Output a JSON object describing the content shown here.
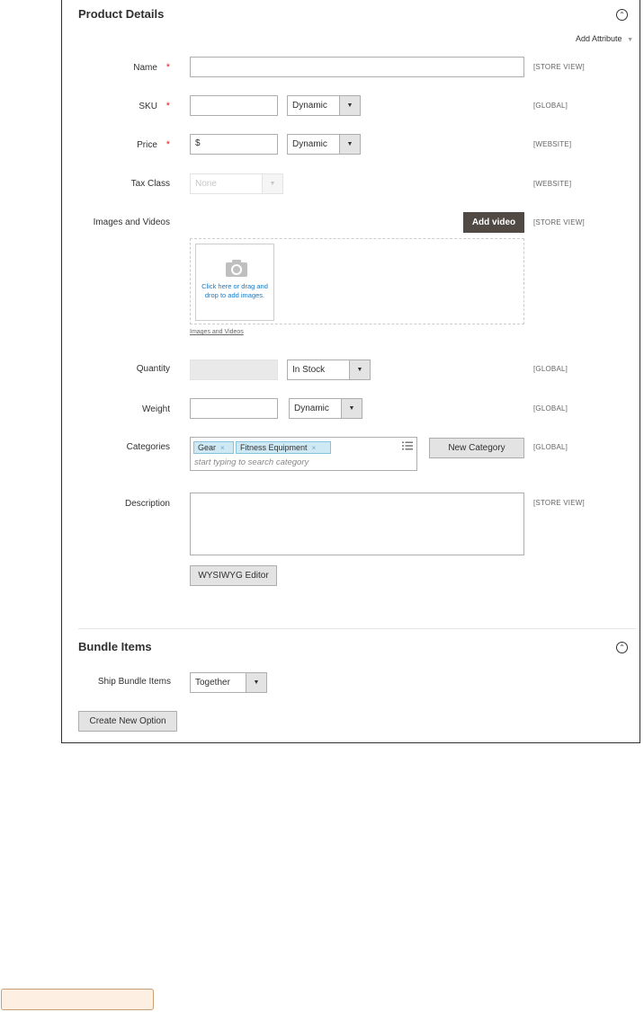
{
  "product_details": {
    "title": "Product Details",
    "add_attribute": "Add Attribute",
    "fields": {
      "name": {
        "label": "Name",
        "required": "*",
        "value": "",
        "scope": "[STORE VIEW]"
      },
      "sku": {
        "label": "SKU",
        "required": "*",
        "value": "",
        "mode": "Dynamic",
        "scope": "[GLOBAL]"
      },
      "price": {
        "label": "Price",
        "required": "*",
        "prefix": "$",
        "mode": "Dynamic",
        "scope": "[WEBSITE]"
      },
      "tax_class": {
        "label": "Tax Class",
        "value": "None",
        "scope": "[WEBSITE]"
      },
      "images": {
        "label": "Images and Videos",
        "add_video": "Add video",
        "upload_text": "Click here or drag and drop to add images.",
        "link": "Images and Videos",
        "scope": "[STORE VIEW]"
      },
      "quantity": {
        "label": "Quantity",
        "value": "",
        "stock_status": "In Stock",
        "scope": "[GLOBAL]"
      },
      "weight": {
        "label": "Weight",
        "value": "",
        "mode": "Dynamic",
        "scope": "[GLOBAL]"
      },
      "categories": {
        "label": "Categories",
        "tags": [
          "Gear",
          "Fitness Equipment"
        ],
        "remove_glyph": "×",
        "placeholder": "start typing to search category",
        "new_category": "New Category",
        "scope": "[GLOBAL]"
      },
      "description": {
        "label": "Description",
        "value": "",
        "wysiwyg": "WYSIWYG Editor",
        "scope": "[STORE VIEW]"
      }
    }
  },
  "bundle_items": {
    "title": "Bundle Items",
    "ship_label": "Ship Bundle Items",
    "ship_value": "Together",
    "create_option": "Create New Option"
  },
  "colors": {
    "required": "#e22626",
    "dark_button": "#514943",
    "tag_bg": "#cfe9f4",
    "upload_link": "#1979c3"
  },
  "icons": {
    "collapse": "collapse-icon",
    "camera": "camera-icon",
    "dropdown": "chevron-down-icon",
    "list": "list-icon"
  }
}
